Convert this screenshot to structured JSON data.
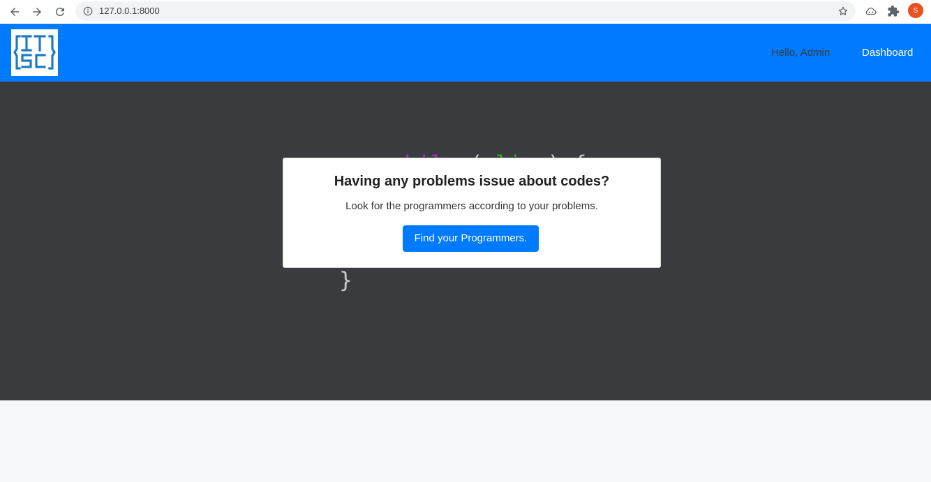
{
  "browser": {
    "url": "127.0.0.1:8000",
    "profile_initial": "S",
    "icons": [
      "back-icon",
      "forward-icon",
      "reload-icon",
      "info-icon",
      "star-icon",
      "extension-cloud-icon",
      "puzzle-icon"
    ]
  },
  "navbar": {
    "logo_text": "ITSC",
    "greeting": "Hello, Admin",
    "dashboard_link": "Dashboard",
    "bg_color": "#007bff"
  },
  "hero": {
    "code": {
      "keyword": "while",
      "open_paren": "(",
      "variable": "alive",
      "close_paren_brace": ") {",
      "closing_brace": "}"
    },
    "bg_color": "#3a3b3e"
  },
  "card": {
    "title": "Having any problems issue about codes?",
    "text": "Look for the programmers according to your problems.",
    "button_label": "Find your Programmers."
  }
}
